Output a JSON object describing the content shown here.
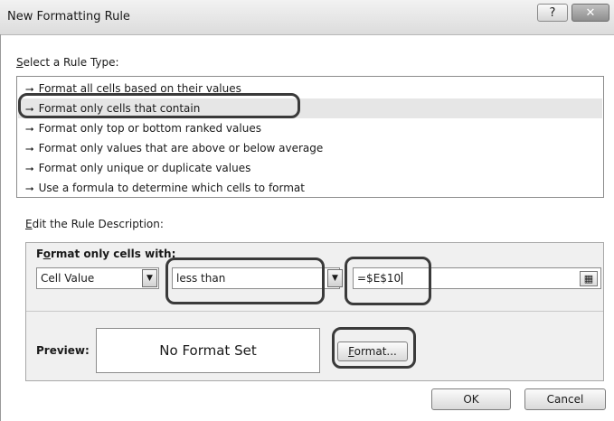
{
  "window": {
    "title": "New Formatting Rule",
    "help_label": "?",
    "close_label": "✕"
  },
  "rule_type": {
    "label_accel": "S",
    "label_rest": "elect a Rule Type:",
    "items": [
      {
        "label": "Format all cells based on their values"
      },
      {
        "label": "Format only cells that contain"
      },
      {
        "label": "Format only top or bottom ranked values"
      },
      {
        "label": "Format only values that are above or below average"
      },
      {
        "label": "Format only unique or duplicate values"
      },
      {
        "label": "Use a formula to determine which cells to format"
      }
    ],
    "selected_index": 1
  },
  "description": {
    "label_accel": "E",
    "label_rest": "dit the Rule Description:",
    "format_only_prefix": "F",
    "format_only_accel": "o",
    "format_only_rest": "rmat only cells with:",
    "condition_type": "Cell Value",
    "operator": "less than",
    "value": "=$E$10"
  },
  "preview": {
    "label": "Preview:",
    "text": "No Format Set"
  },
  "buttons": {
    "format_accel": "F",
    "format_rest": "ormat...",
    "ok": "OK",
    "cancel": "Cancel"
  },
  "icons": {
    "arrow": "right-arrow-icon",
    "dropdown": "chevron-down-icon",
    "range_picker": "collapse-dialog-icon"
  }
}
